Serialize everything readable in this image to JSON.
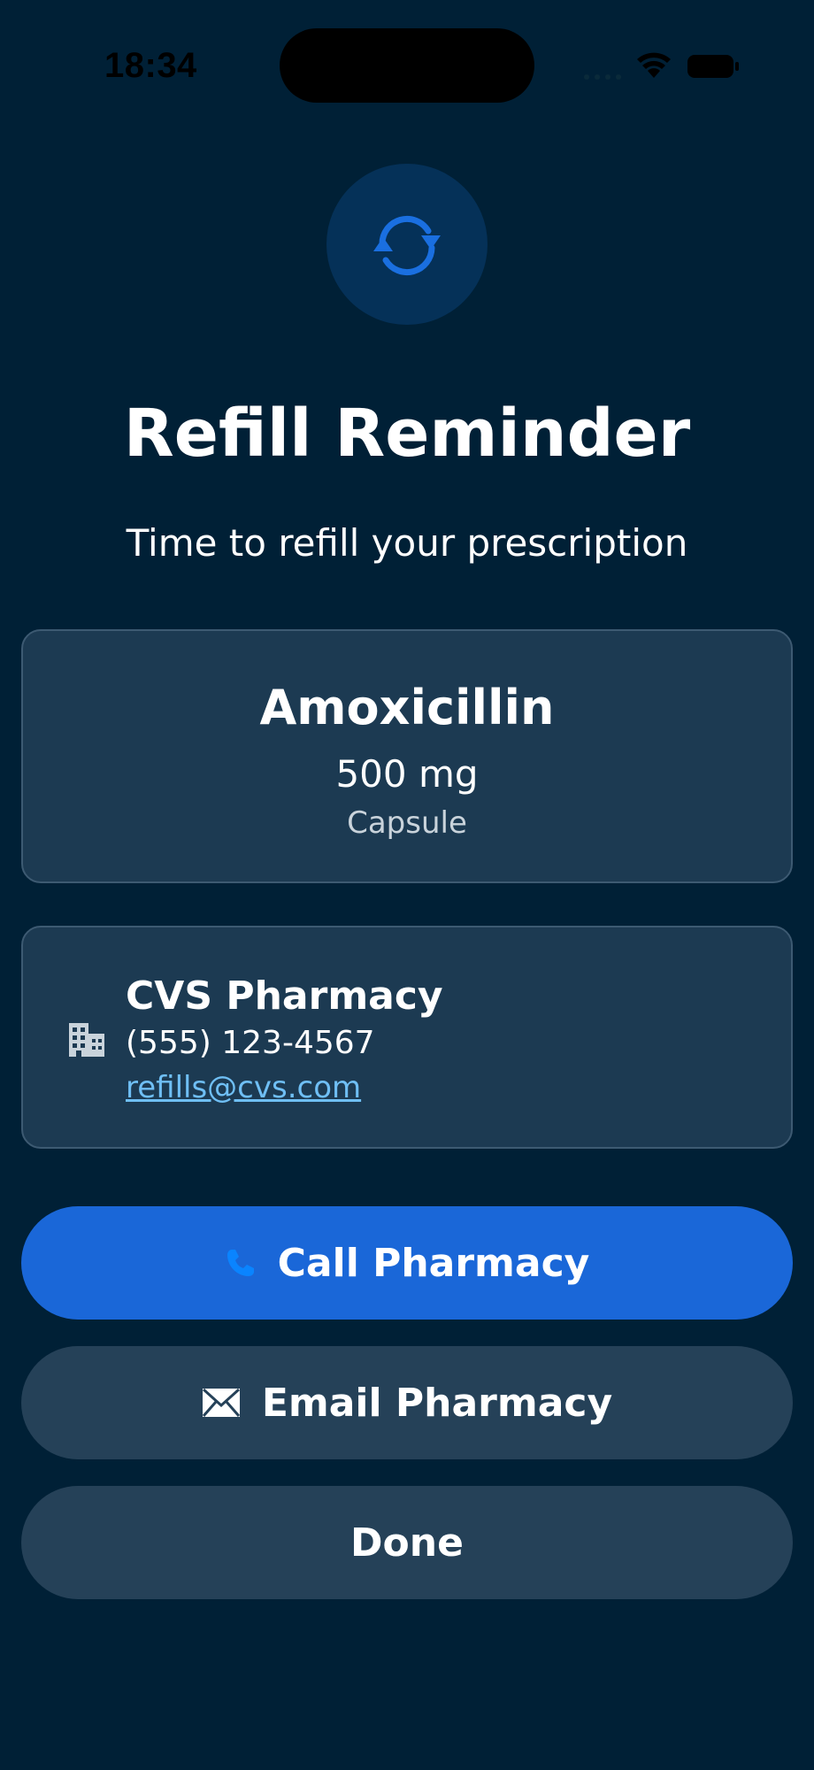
{
  "status_bar": {
    "time": "18:34"
  },
  "header": {
    "icon": "refresh-icon",
    "title": "Refill Reminder",
    "subtitle": "Time to refill your prescription"
  },
  "medication": {
    "name": "Amoxicillin",
    "dose": "500 mg",
    "form": "Capsule"
  },
  "pharmacy": {
    "icon": "building-icon",
    "name": "CVS Pharmacy",
    "phone": "(555) 123-4567",
    "email": "refills@cvs.com"
  },
  "actions": {
    "call_label": "Call Pharmacy",
    "call_icon": "phone-icon",
    "email_label": "Email Pharmacy",
    "email_icon": "envelope-icon",
    "done_label": "Done"
  },
  "colors": {
    "background": "#002036",
    "card": "#1c3a52",
    "accent": "#1a67d8",
    "secondary_button": "#254158",
    "link": "#6fbff5"
  }
}
